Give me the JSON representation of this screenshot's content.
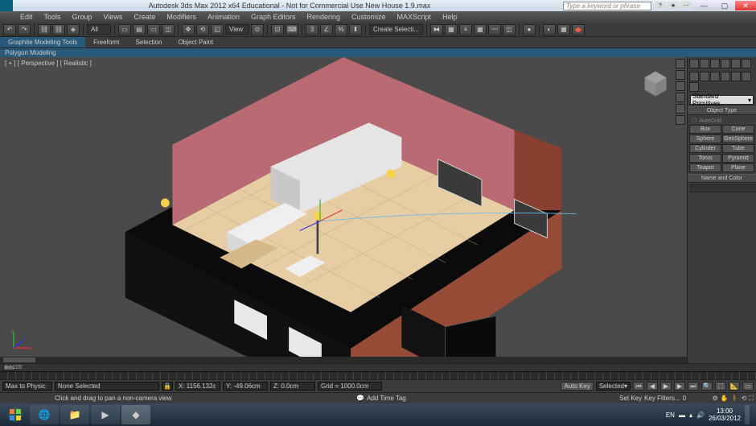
{
  "titlebar": {
    "title": "Autodesk 3ds Max 2012 x64 Educational - Not for Commercial Use   New House 1.9.max",
    "search_placeholder": "Type a keyword or phrase"
  },
  "menubar": [
    "Edit",
    "Tools",
    "Group",
    "Views",
    "Create",
    "Modifiers",
    "Animation",
    "Graph Editors",
    "Rendering",
    "Customize",
    "MAXScript",
    "Help"
  ],
  "toolbar": {
    "dd_all": "All",
    "dd_view": "View",
    "dd_create": "Create Selecti..."
  },
  "ribbon": {
    "tabs": [
      "Graphite Modeling Tools",
      "Freeform",
      "Selection",
      "Object Paint"
    ],
    "sub": "Polygon Modeling"
  },
  "viewport": {
    "label": "[ + ] [ Perspective ] [ Realistic ]"
  },
  "cmdpanel": {
    "category": "Standard Primitives",
    "roll1": "Object Type",
    "autogrid": "AutoGrid",
    "primitives": [
      [
        "Box",
        "Cone"
      ],
      [
        "Sphere",
        "GeoSphere"
      ],
      [
        "Cylinder",
        "Tube"
      ],
      [
        "Torus",
        "Pyramid"
      ],
      [
        "Teapot",
        "Plane"
      ]
    ],
    "roll2": "Name and Color"
  },
  "timeline": {
    "range": "0 / 100"
  },
  "status": {
    "script": "Max to Physic",
    "none": "None Selected",
    "x": "X: 1156.132c",
    "y": "Y: -49.06cm",
    "z": "Z: 0.0cm",
    "grid": "Grid = 1000.0cm",
    "autokey": "Auto Key",
    "selected": "Selected",
    "hint": "Click and drag to pan a non-camera view",
    "addtag": "Add Time Tag",
    "setkey": "Set Key",
    "keyfilters": "Key Filters...",
    "frame": "0",
    "lock_icon": "🔒"
  },
  "taskbar": {
    "time": "13:00",
    "date": "26/03/2012",
    "lang": "EN"
  }
}
